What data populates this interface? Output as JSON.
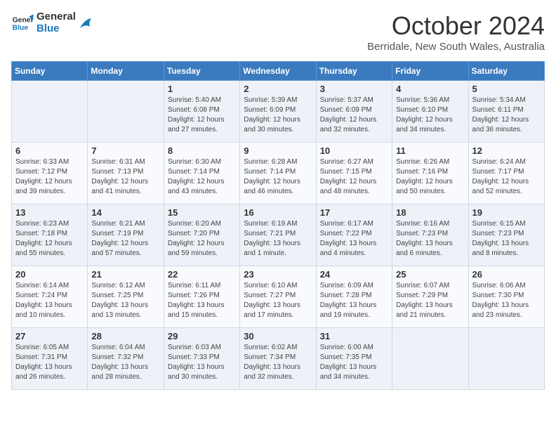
{
  "logo": {
    "line1": "General",
    "line2": "Blue"
  },
  "title": "October 2024",
  "subtitle": "Berridale, New South Wales, Australia",
  "headers": [
    "Sunday",
    "Monday",
    "Tuesday",
    "Wednesday",
    "Thursday",
    "Friday",
    "Saturday"
  ],
  "weeks": [
    [
      {
        "day": "",
        "info": ""
      },
      {
        "day": "",
        "info": ""
      },
      {
        "day": "1",
        "info": "Sunrise: 5:40 AM\nSunset: 6:08 PM\nDaylight: 12 hours\nand 27 minutes."
      },
      {
        "day": "2",
        "info": "Sunrise: 5:39 AM\nSunset: 6:09 PM\nDaylight: 12 hours\nand 30 minutes."
      },
      {
        "day": "3",
        "info": "Sunrise: 5:37 AM\nSunset: 6:09 PM\nDaylight: 12 hours\nand 32 minutes."
      },
      {
        "day": "4",
        "info": "Sunrise: 5:36 AM\nSunset: 6:10 PM\nDaylight: 12 hours\nand 34 minutes."
      },
      {
        "day": "5",
        "info": "Sunrise: 5:34 AM\nSunset: 6:11 PM\nDaylight: 12 hours\nand 36 minutes."
      }
    ],
    [
      {
        "day": "6",
        "info": "Sunrise: 6:33 AM\nSunset: 7:12 PM\nDaylight: 12 hours\nand 39 minutes."
      },
      {
        "day": "7",
        "info": "Sunrise: 6:31 AM\nSunset: 7:13 PM\nDaylight: 12 hours\nand 41 minutes."
      },
      {
        "day": "8",
        "info": "Sunrise: 6:30 AM\nSunset: 7:14 PM\nDaylight: 12 hours\nand 43 minutes."
      },
      {
        "day": "9",
        "info": "Sunrise: 6:28 AM\nSunset: 7:14 PM\nDaylight: 12 hours\nand 46 minutes."
      },
      {
        "day": "10",
        "info": "Sunrise: 6:27 AM\nSunset: 7:15 PM\nDaylight: 12 hours\nand 48 minutes."
      },
      {
        "day": "11",
        "info": "Sunrise: 6:26 AM\nSunset: 7:16 PM\nDaylight: 12 hours\nand 50 minutes."
      },
      {
        "day": "12",
        "info": "Sunrise: 6:24 AM\nSunset: 7:17 PM\nDaylight: 12 hours\nand 52 minutes."
      }
    ],
    [
      {
        "day": "13",
        "info": "Sunrise: 6:23 AM\nSunset: 7:18 PM\nDaylight: 12 hours\nand 55 minutes."
      },
      {
        "day": "14",
        "info": "Sunrise: 6:21 AM\nSunset: 7:19 PM\nDaylight: 12 hours\nand 57 minutes."
      },
      {
        "day": "15",
        "info": "Sunrise: 6:20 AM\nSunset: 7:20 PM\nDaylight: 12 hours\nand 59 minutes."
      },
      {
        "day": "16",
        "info": "Sunrise: 6:19 AM\nSunset: 7:21 PM\nDaylight: 13 hours\nand 1 minute."
      },
      {
        "day": "17",
        "info": "Sunrise: 6:17 AM\nSunset: 7:22 PM\nDaylight: 13 hours\nand 4 minutes."
      },
      {
        "day": "18",
        "info": "Sunrise: 6:16 AM\nSunset: 7:23 PM\nDaylight: 13 hours\nand 6 minutes."
      },
      {
        "day": "19",
        "info": "Sunrise: 6:15 AM\nSunset: 7:23 PM\nDaylight: 13 hours\nand 8 minutes."
      }
    ],
    [
      {
        "day": "20",
        "info": "Sunrise: 6:14 AM\nSunset: 7:24 PM\nDaylight: 13 hours\nand 10 minutes."
      },
      {
        "day": "21",
        "info": "Sunrise: 6:12 AM\nSunset: 7:25 PM\nDaylight: 13 hours\nand 13 minutes."
      },
      {
        "day": "22",
        "info": "Sunrise: 6:11 AM\nSunset: 7:26 PM\nDaylight: 13 hours\nand 15 minutes."
      },
      {
        "day": "23",
        "info": "Sunrise: 6:10 AM\nSunset: 7:27 PM\nDaylight: 13 hours\nand 17 minutes."
      },
      {
        "day": "24",
        "info": "Sunrise: 6:09 AM\nSunset: 7:28 PM\nDaylight: 13 hours\nand 19 minutes."
      },
      {
        "day": "25",
        "info": "Sunrise: 6:07 AM\nSunset: 7:29 PM\nDaylight: 13 hours\nand 21 minutes."
      },
      {
        "day": "26",
        "info": "Sunrise: 6:06 AM\nSunset: 7:30 PM\nDaylight: 13 hours\nand 23 minutes."
      }
    ],
    [
      {
        "day": "27",
        "info": "Sunrise: 6:05 AM\nSunset: 7:31 PM\nDaylight: 13 hours\nand 26 minutes."
      },
      {
        "day": "28",
        "info": "Sunrise: 6:04 AM\nSunset: 7:32 PM\nDaylight: 13 hours\nand 28 minutes."
      },
      {
        "day": "29",
        "info": "Sunrise: 6:03 AM\nSunset: 7:33 PM\nDaylight: 13 hours\nand 30 minutes."
      },
      {
        "day": "30",
        "info": "Sunrise: 6:02 AM\nSunset: 7:34 PM\nDaylight: 13 hours\nand 32 minutes."
      },
      {
        "day": "31",
        "info": "Sunrise: 6:00 AM\nSunset: 7:35 PM\nDaylight: 13 hours\nand 34 minutes."
      },
      {
        "day": "",
        "info": ""
      },
      {
        "day": "",
        "info": ""
      }
    ]
  ]
}
